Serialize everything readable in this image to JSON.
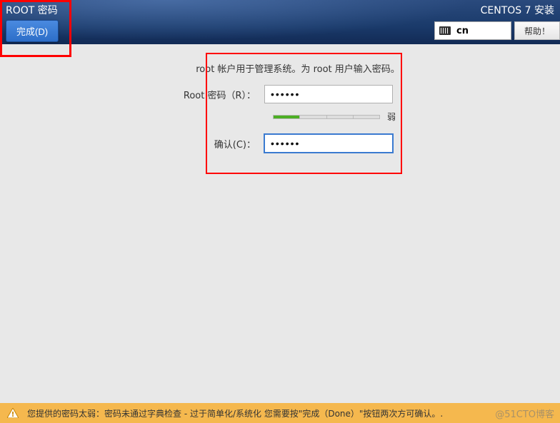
{
  "header": {
    "page_title": "ROOT 密码",
    "done_label": "完成(D)",
    "install_title": "CENTOS 7 安装",
    "lang_code": "cn",
    "help_label": "帮助！"
  },
  "form": {
    "instruction": "root 帐户用于管理系统。为 root 用户输入密码。",
    "password_label": "Root 密码（R）：",
    "confirm_label": "确认(C)：",
    "password_value": "••••••",
    "confirm_value": "••••••",
    "strength_text": "弱"
  },
  "warning": {
    "message": "您提供的密码太弱：密码未通过字典检查 - 过于简单化/系统化 您需要按\"完成（Done）\"按钮两次方可确认。."
  },
  "watermark": "@51CTO博客"
}
